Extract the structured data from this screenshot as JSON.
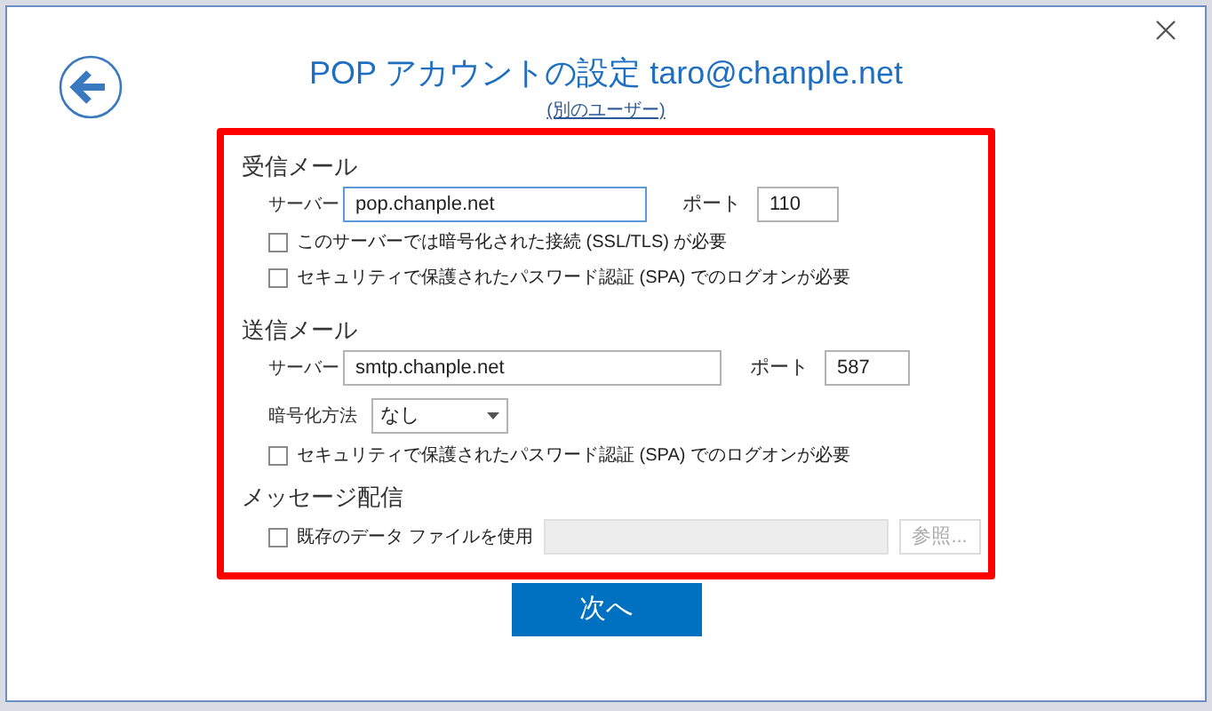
{
  "dialog": {
    "title": "POP アカウントの設定 taro@chanple.net",
    "other_user_link": "(別のユーザー)"
  },
  "incoming": {
    "heading": "受信メール",
    "server_label": "サーバー",
    "server": "pop.chanple.net",
    "server_focused": true,
    "port_label": "ポート",
    "port": "110",
    "options": [
      {
        "label": "このサーバーでは暗号化された接続 (SSL/TLS) が必要",
        "checked": false
      },
      {
        "label": "セキュリティで保護されたパスワード認証 (SPA) でのログオンが必要",
        "checked": false
      }
    ]
  },
  "outgoing": {
    "heading": "送信メール",
    "server_label": "サーバー",
    "server": "smtp.chanple.net",
    "server_focused": false,
    "port_label": "ポート",
    "port": "587",
    "encryption_label": "暗号化方法",
    "encryption": "なし",
    "options": [
      {
        "label": "セキュリティで保護されたパスワード認証 (SPA) でのログオンが必要",
        "checked": false
      }
    ]
  },
  "delivery": {
    "heading": "メッセージ配信",
    "option": {
      "label": "既存のデータ ファイルを使用",
      "checked": false
    },
    "file_field_disabled": true,
    "browse_button": {
      "label": "参照...",
      "disabled": true
    }
  },
  "next_button": "次へ"
}
